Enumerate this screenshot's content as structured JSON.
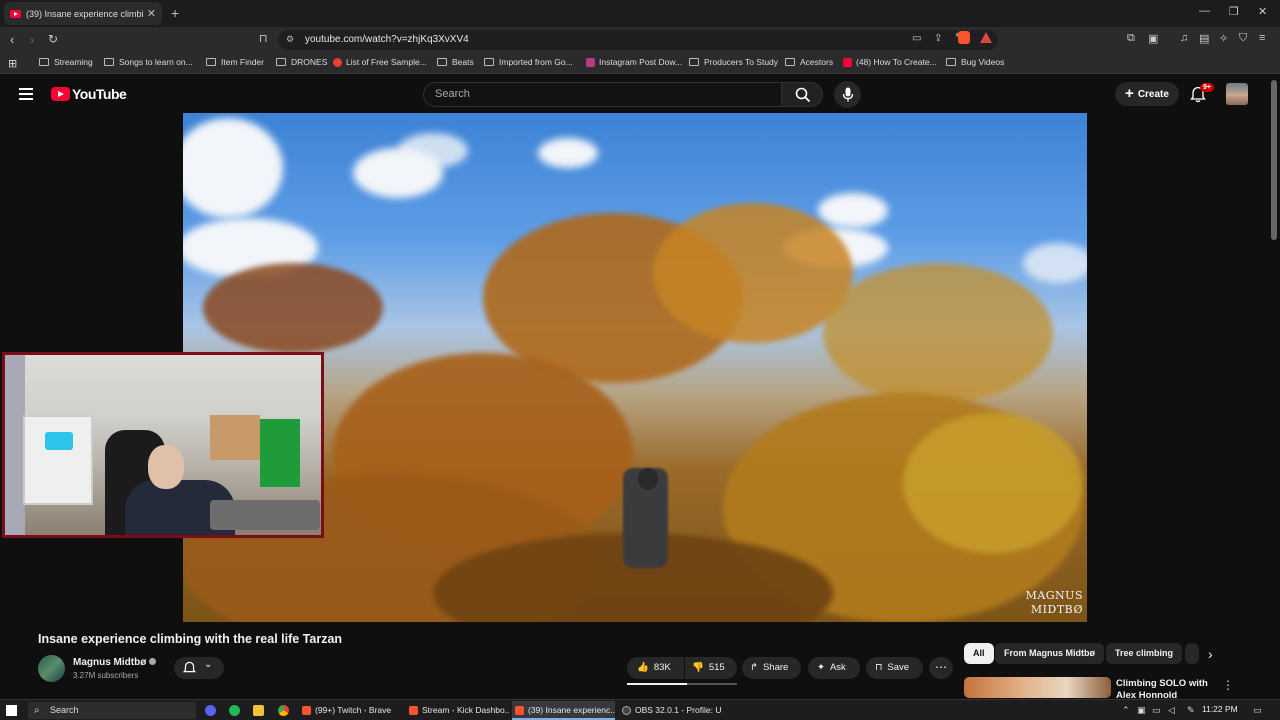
{
  "browser": {
    "active_tab_title": "(39) Insane experience climbi",
    "url": "youtube.com/watch?v=zhjKq3XvXV4"
  },
  "bookmarks": [
    {
      "label": "Streaming",
      "icon": "folder-icon"
    },
    {
      "label": "Songs to learn on...",
      "icon": "folder-icon"
    },
    {
      "label": "Item Finder",
      "icon": "folder-icon"
    },
    {
      "label": "DRONES",
      "icon": "folder-icon"
    },
    {
      "label": "List of Free Sample...",
      "icon": "site-icon"
    },
    {
      "label": "Beats",
      "icon": "folder-icon"
    },
    {
      "label": "Imported from Go...",
      "icon": "folder-icon"
    },
    {
      "label": "Instagram Post Dow...",
      "icon": "site-icon"
    },
    {
      "label": "Producers To Study",
      "icon": "folder-icon"
    },
    {
      "label": "Acestors",
      "icon": "folder-icon"
    },
    {
      "label": "(48) How To Create...",
      "icon": "youtube-icon"
    },
    {
      "label": "Bug Videos",
      "icon": "folder-icon"
    }
  ],
  "youtube": {
    "logo_text": "YouTube",
    "search_placeholder": "Search",
    "create_label": "Create",
    "notifications_badge": "9+"
  },
  "video": {
    "title": "Insane experience climbing with the real life Tarzan",
    "watermark_line1": "MAGNUS",
    "watermark_line2": "MIDTBØ",
    "channel_name": "Magnus Midtbø",
    "subscribers": "3.27M subscribers",
    "likes": "83K",
    "dislikes": "515",
    "share_label": "Share",
    "ask_label": "Ask",
    "save_label": "Save"
  },
  "chips": [
    {
      "label": "All",
      "active": true
    },
    {
      "label": "From Magnus Midtbø",
      "active": false
    },
    {
      "label": "Tree climbing",
      "active": false
    }
  ],
  "recommendation": {
    "title": "Climbing SOLO with Alex Honnold"
  },
  "taskbar": {
    "search_label": "Search",
    "apps": [
      {
        "label": "(99+) Twitch - Brave"
      },
      {
        "label": "Stream - Kick Dashbo..."
      },
      {
        "label": "(39) Insane experienc..."
      },
      {
        "label": "OBS 32.0.1 - Profile: U..."
      }
    ],
    "time": "11:22 PM"
  },
  "colors": {
    "youtube_red": "#ff0033",
    "page_bg": "#0f0f0f",
    "webcam_border": "#7a0d18"
  }
}
